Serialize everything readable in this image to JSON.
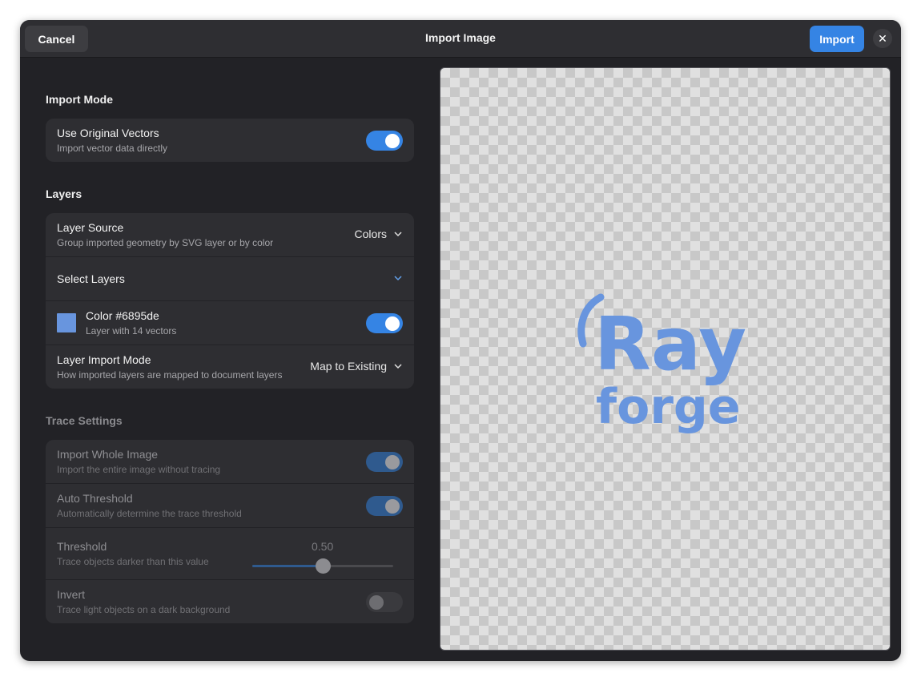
{
  "header": {
    "cancel_label": "Cancel",
    "title": "Import Image",
    "import_label": "Import",
    "close_glyph": "✕"
  },
  "import_mode": {
    "section_title": "Import Mode",
    "use_original_vectors": {
      "title": "Use Original Vectors",
      "subtitle": "Import vector data directly",
      "enabled": true
    }
  },
  "layers": {
    "section_title": "Layers",
    "layer_source": {
      "title": "Layer Source",
      "subtitle": "Group imported geometry by SVG layer or by color",
      "value": "Colors"
    },
    "select_layers": {
      "title": "Select Layers"
    },
    "color_layer": {
      "title": "Color #6895de",
      "subtitle": "Layer with 14 vectors",
      "color": "#6895de",
      "enabled": true
    },
    "layer_import_mode": {
      "title": "Layer Import Mode",
      "subtitle": "How imported layers are mapped to document layers",
      "value": "Map to Existing"
    }
  },
  "trace_settings": {
    "section_title": "Trace Settings",
    "import_whole_image": {
      "title": "Import Whole Image",
      "subtitle": "Import the entire image without tracing",
      "enabled": true
    },
    "auto_threshold": {
      "title": "Auto Threshold",
      "subtitle": "Automatically determine the trace threshold",
      "enabled": true
    },
    "threshold": {
      "title": "Threshold",
      "subtitle": "Trace objects darker than this value",
      "value_label": "0.50",
      "value": 0.5
    },
    "invert": {
      "title": "Invert",
      "subtitle": "Trace light objects on a dark background",
      "enabled": false
    }
  },
  "preview": {
    "logo_line1": "Ray",
    "logo_line2": "forge",
    "logo_color": "#6895de"
  },
  "colors": {
    "accent": "#3584e4",
    "window_bg": "#222226",
    "card_bg": "#2e2e32"
  }
}
